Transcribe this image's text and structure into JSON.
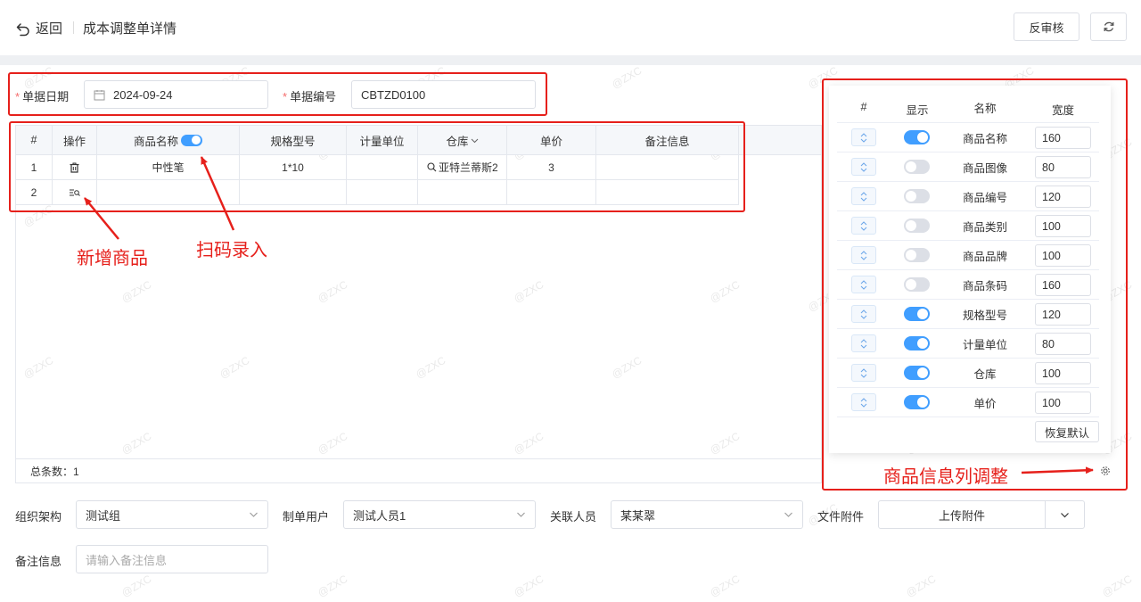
{
  "header": {
    "back_label": "返回",
    "title": "成本调整单详情",
    "unaudit_label": "反审核"
  },
  "form_top": {
    "date_label": "单据日期",
    "date_value": "2024-09-24",
    "code_label": "单据编号",
    "code_value": "CBTZD0100"
  },
  "table": {
    "columns": {
      "index": "#",
      "ops": "操作",
      "name": "商品名称",
      "spec": "规格型号",
      "unit": "计量单位",
      "warehouse": "仓库",
      "price": "单价",
      "remark": "备注信息"
    },
    "rows": [
      {
        "index": "1",
        "name": "中性笔",
        "spec": "1*10",
        "unit": "",
        "warehouse": "亚特兰蒂斯2",
        "price": "3",
        "remark": ""
      },
      {
        "index": "2",
        "name": "",
        "spec": "",
        "unit": "",
        "warehouse": "",
        "price": "",
        "remark": ""
      }
    ],
    "total_label": "总条数：",
    "total_value": "1"
  },
  "column_panel": {
    "headers": {
      "index": "#",
      "show": "显示",
      "name": "名称",
      "width": "宽度"
    },
    "rows": [
      {
        "name": "商品名称",
        "show": true,
        "width": "160"
      },
      {
        "name": "商品图像",
        "show": false,
        "width": "80"
      },
      {
        "name": "商品编号",
        "show": false,
        "width": "120"
      },
      {
        "name": "商品类别",
        "show": false,
        "width": "100"
      },
      {
        "name": "商品品牌",
        "show": false,
        "width": "100"
      },
      {
        "name": "商品条码",
        "show": false,
        "width": "160"
      },
      {
        "name": "规格型号",
        "show": true,
        "width": "120"
      },
      {
        "name": "计量单位",
        "show": true,
        "width": "80"
      },
      {
        "name": "仓库",
        "show": true,
        "width": "100"
      },
      {
        "name": "单价",
        "show": true,
        "width": "100"
      }
    ],
    "reset_label": "恢复默认"
  },
  "form_bottom": {
    "org_label": "组织架构",
    "org_value": "测试组",
    "creator_label": "制单用户",
    "creator_value": "测试人员1",
    "related_label": "关联人员",
    "related_value": "某某翠",
    "attach_label": "文件附件",
    "attach_button": "上传附件",
    "remark_label": "备注信息",
    "remark_placeholder": "请输入备注信息"
  },
  "annotations": {
    "add_product": "新增商品",
    "scan_entry": "扫码录入",
    "column_adjust": "商品信息列调整"
  },
  "watermark": "@ZXC",
  "colors": {
    "accent": "#409eff",
    "annotation": "#e6201b",
    "required": "#f56c6c"
  }
}
